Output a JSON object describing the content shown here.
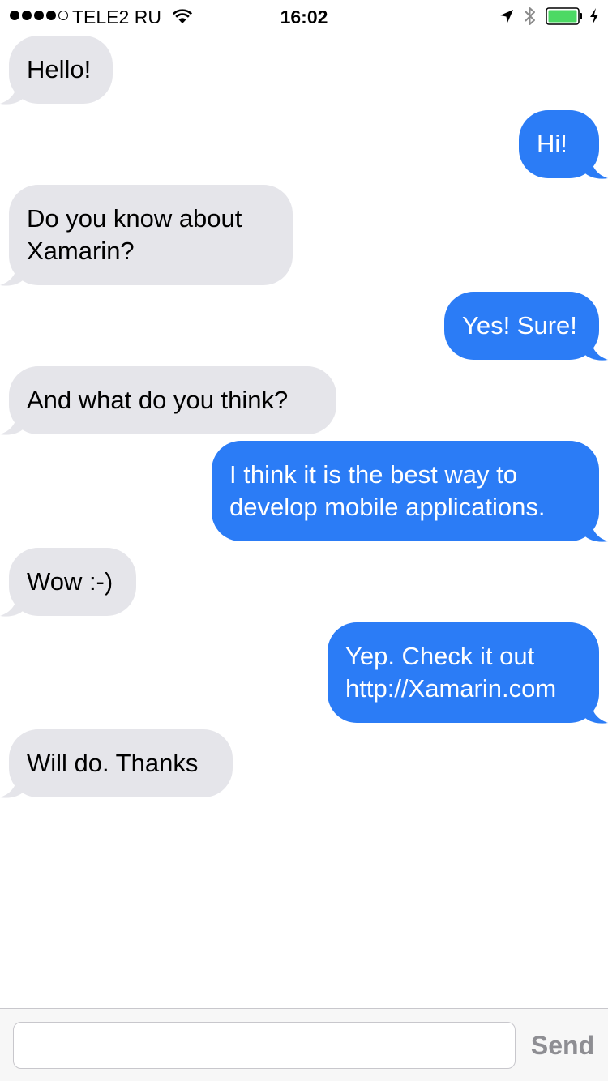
{
  "status_bar": {
    "carrier": "TELE2 RU",
    "time": "16:02",
    "signal_strength": "4 of 5",
    "icons": [
      "signal-dots",
      "wifi-icon",
      "location-arrow-icon",
      "bluetooth-icon",
      "battery-icon",
      "charging-bolt-icon"
    ],
    "battery_color": "#4cd964"
  },
  "messages": [
    {
      "direction": "incoming",
      "text": "Hello!"
    },
    {
      "direction": "outgoing",
      "text": "Hi!"
    },
    {
      "direction": "incoming",
      "text": "Do you know about\nXamarin?"
    },
    {
      "direction": "outgoing",
      "text": "Yes! Sure!"
    },
    {
      "direction": "incoming",
      "text": "And what do you think?"
    },
    {
      "direction": "outgoing",
      "text": "I think it is the best way to\ndevelop mobile applications."
    },
    {
      "direction": "incoming",
      "text": "Wow :-)"
    },
    {
      "direction": "outgoing",
      "text": "Yep. Check it out\nhttp://Xamarin.com"
    },
    {
      "direction": "incoming",
      "text": "Will do. Thanks"
    }
  ],
  "colors": {
    "incoming_bubble": "#e5e5ea",
    "outgoing_bubble": "#2b7cf6",
    "send_disabled": "#8e8e93"
  },
  "input_bar": {
    "value": "",
    "placeholder": "",
    "send_label": "Send"
  }
}
